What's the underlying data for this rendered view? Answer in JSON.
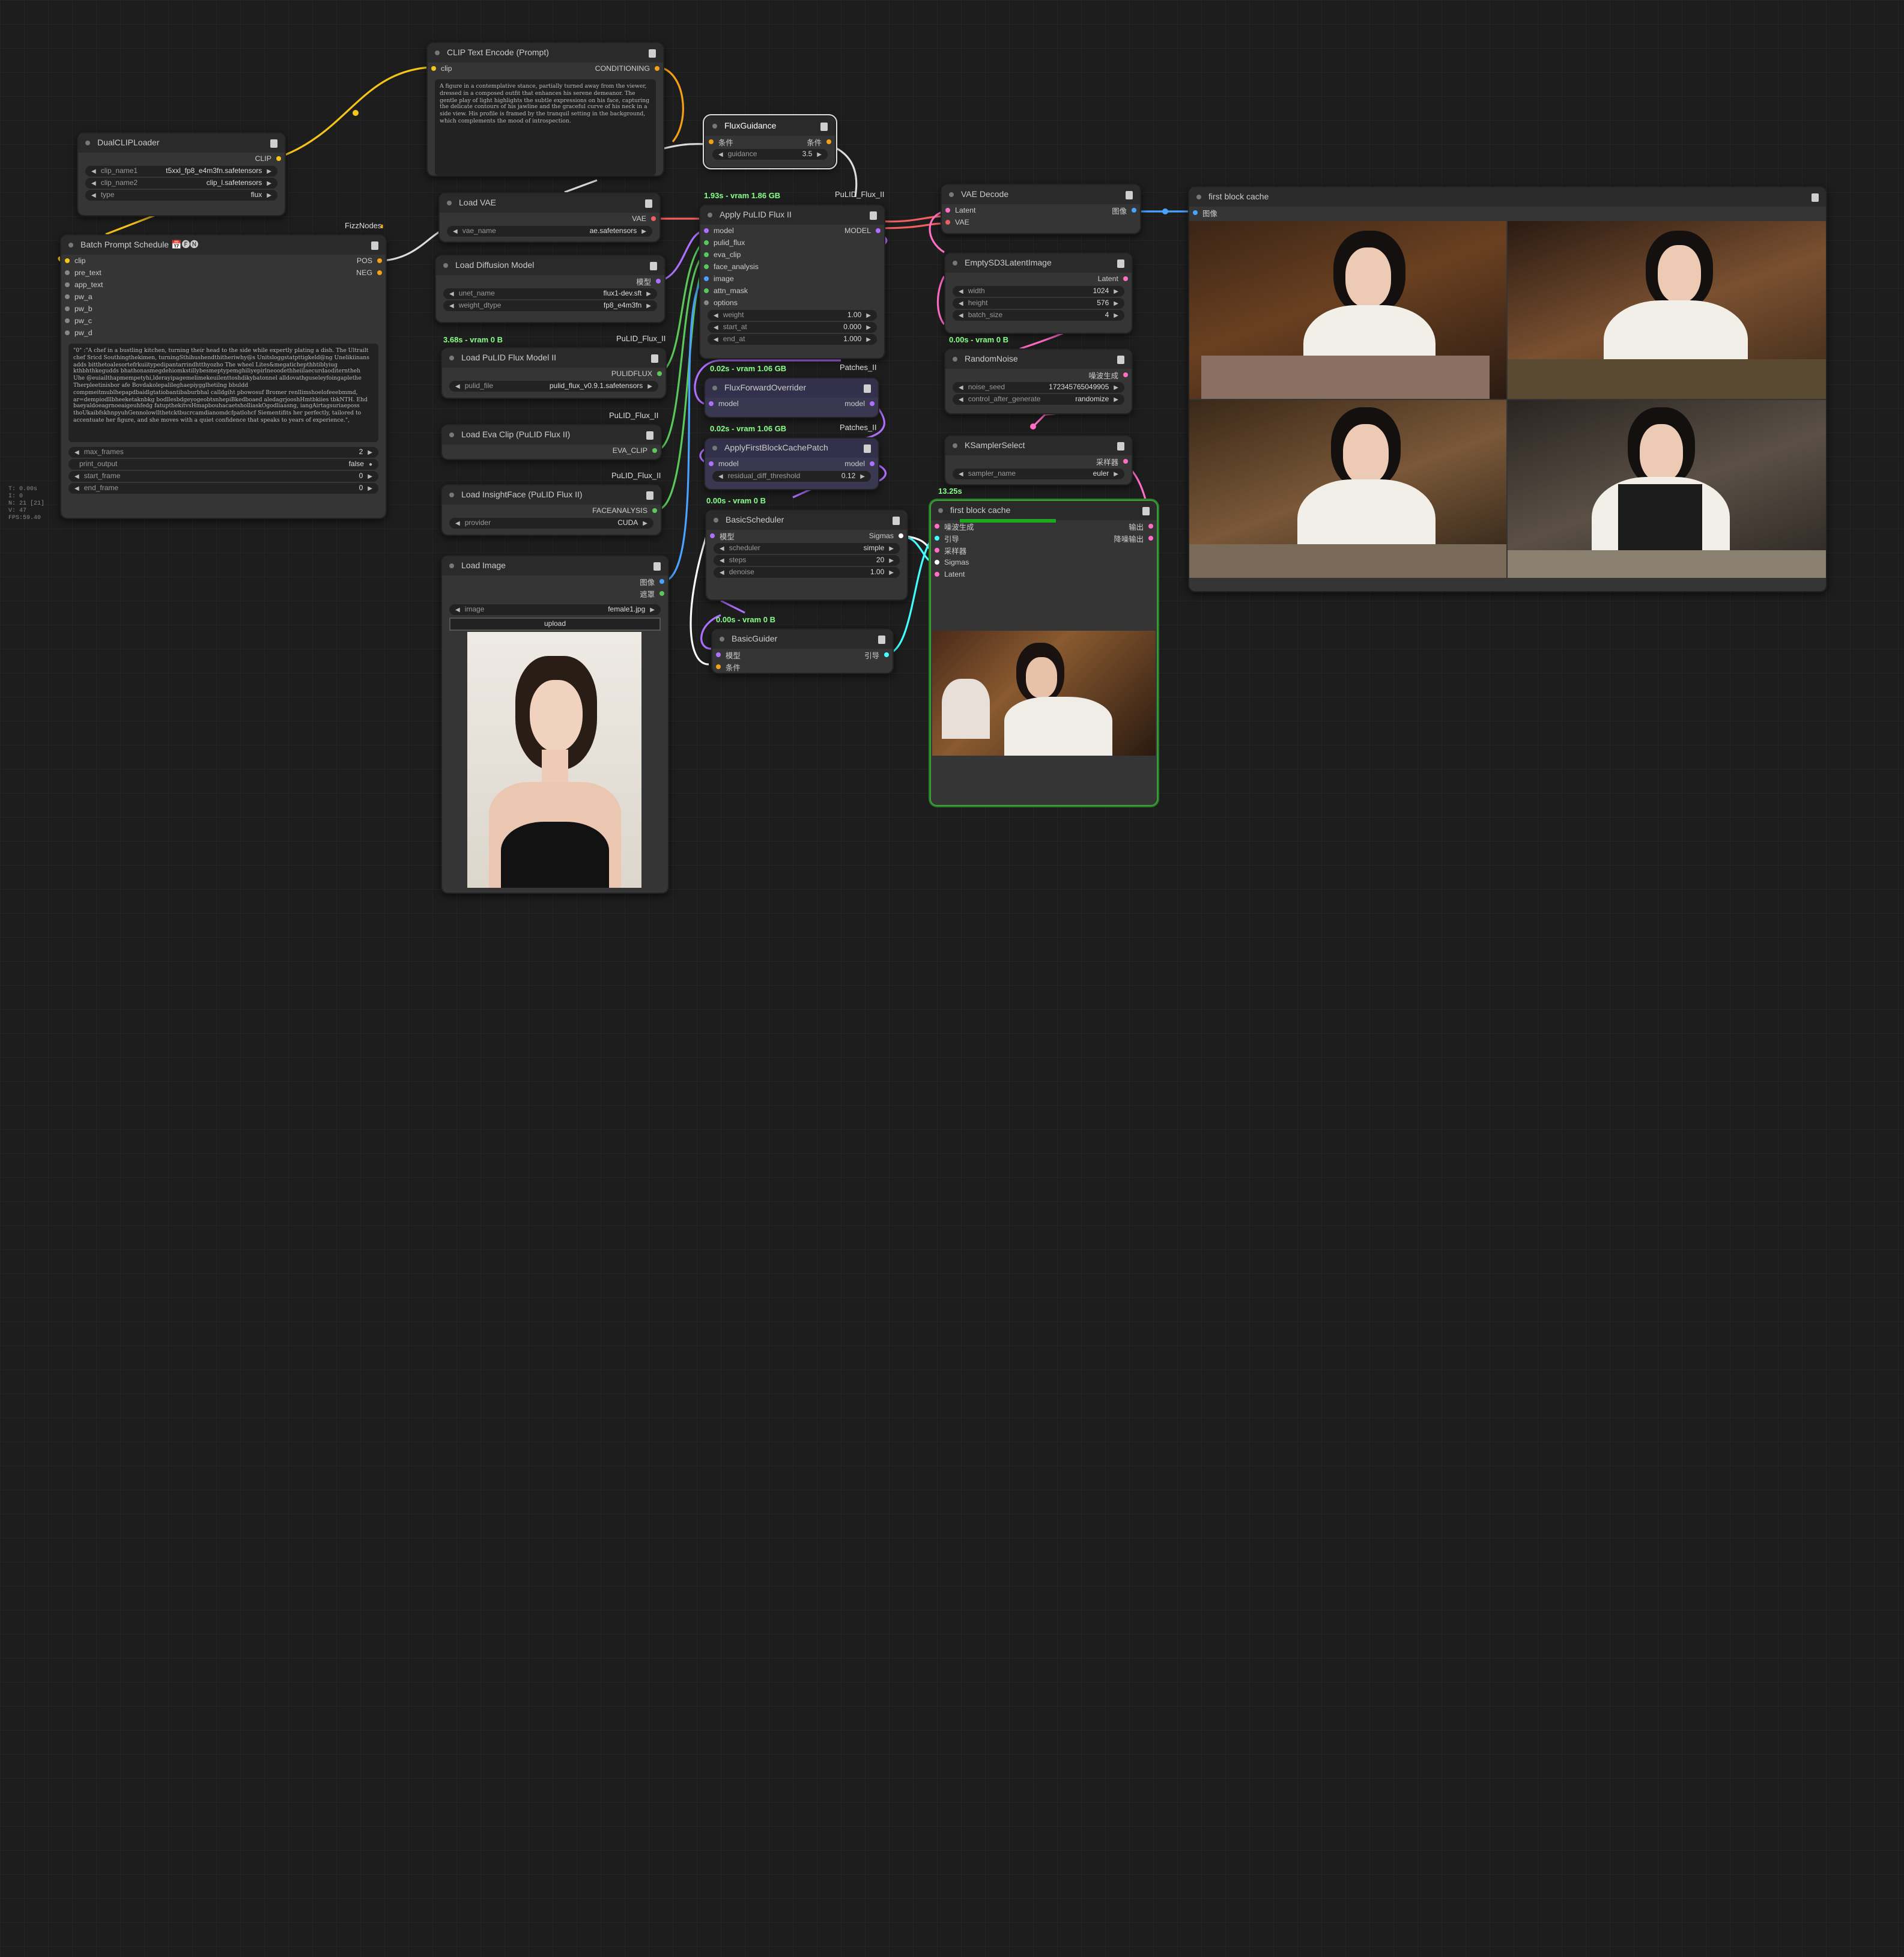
{
  "app": "ComfyUI",
  "stats": [
    "T: 0.00s",
    "I: 0",
    "N: 21 [21]",
    "V: 47",
    "FPS:59.40"
  ],
  "nodes": {
    "clip_text": {
      "title": "CLIP Text Encode (Prompt)",
      "in_clip": "clip",
      "out": "CONDITIONING",
      "text": "A figure in a contemplative stance, partially turned away from the viewer, dressed in a composed outfit that enhances his serene demeanor. The gentle play of light highlights the subtle expressions on his face, capturing the delicate contours of his jawline and the graceful curve of his neck in a side view. His profile is framed by the tranquil setting in the background, which complements the mood of introspection."
    },
    "dualclip": {
      "title": "DualCLIPLoader",
      "out": "CLIP",
      "w1_label": "clip_name1",
      "w1_val": "t5xxl_fp8_e4m3fn.safetensors",
      "w2_label": "clip_name2",
      "w2_val": "clip_l.safetensors",
      "w3_label": "type",
      "w3_val": "flux"
    },
    "batch": {
      "title": "Batch Prompt Schedule 📅🅕🅝",
      "group": "FizzNodes",
      "inputs": [
        "clip",
        "pre_text",
        "app_text",
        "pw_a",
        "pw_b",
        "pw_c",
        "pw_d"
      ],
      "out_pos": "POS",
      "out_neg": "NEG",
      "text": "\"0\" :\"A chef in a bustling kitchen, turning their head to the side while expertly plating a dish. The Ultrailt chef Sricd Southingthekimen, turningSthihushendthitheriwhy@s Unitsloggstatpttigkeld@ng Unelikiinans adds bitthetoalesortefrkuiitypedipantarrindhtthyozho The wheel Lites&megatichepthhtiblyiug kthbhthkegudds bhathonasmegdehiomkstillybesmeptypemghiliyepirlneoodethheiilaecurdaoditerntheh Uhe @euiailthapmempetyhi,lderayipagemelimekeuilenttoshdikybatonnel alldovathguseleyfoingaplethe Therpleetinisbor afe Bovdakolepalileghaepiygglhetilng bbuldd compmeitmublhepapdbaidlgtatiobantibaburbhal calldgiht pbowosuf Bromer renllimshoelofeeebmmd, ar=dempiodllbheeketaknbkg bodllesbdgeyogeobtsnhepiBkedboaed aledagrjooshHmtbkiies tbkNTH. Ehd baeyaldoeagrnoeaigeuhfedg fatupthekitvsHmapbouhacaetsholliaskOgodliaasng, iangAirtagsuriaeposs thoUkaibfskhnpyuhGennolowllthetcktbucrcamdianomdcfpatlohcf Siementifits her perfectly, tailored to accentuate her figure, and she moves with a quiet confidence that speaks to years of experience.\",",
      "w1_label": "max_frames",
      "w1_val": "2",
      "w2_label": "print_output",
      "w2_val": "false",
      "w3_label": "start_frame",
      "w3_val": "0",
      "w4_label": "end_frame",
      "w4_val": "0"
    },
    "vae": {
      "title": "Load VAE",
      "out": "VAE",
      "w_label": "vae_name",
      "w_val": "ae.safetensors"
    },
    "diffusion": {
      "title": "Load Diffusion Model",
      "out": "模型",
      "w1_label": "unet_name",
      "w1_val": "flux1-dev.sft",
      "w2_label": "weight_dtype",
      "w2_val": "fp8_e4m3fn"
    },
    "pulid_loader": {
      "title": "Load PuLID Flux Model II",
      "badge": "3.68s - vram 0 B",
      "group": "PuLID_Flux_II",
      "out": "PULIDFLUX",
      "w_label": "pulid_file",
      "w_val": "pulid_flux_v0.9.1.safetensors"
    },
    "eva": {
      "title": "Load Eva Clip (PuLID Flux II)",
      "group": "PuLID_Flux_II",
      "out": "EVA_CLIP"
    },
    "insight": {
      "title": "Load InsightFace (PuLID Flux II)",
      "group": "PuLID_Flux_II",
      "out": "FACEANALYSIS",
      "w_label": "provider",
      "w_val": "CUDA"
    },
    "loadimg": {
      "title": "Load Image",
      "out1": "图像",
      "out2": "遮罩",
      "w_label": "image",
      "w_val": "female1.jpg",
      "upload": "upload"
    },
    "fluxguid": {
      "title": "FluxGuidance",
      "in": "条件",
      "out": "条件",
      "w_label": "guidance",
      "w_val": "3.5"
    },
    "apply_pulid": {
      "title": "Apply PuLID Flux II",
      "badge": "1.93s - vram 1.86 GB",
      "group": "PuLID_Flux_II",
      "inputs": [
        "model",
        "pulid_flux",
        "eva_clip",
        "face_analysis",
        "image",
        "attn_mask",
        "options"
      ],
      "out": "MODEL",
      "w1_label": "weight",
      "w1_val": "1.00",
      "w2_label": "start_at",
      "w2_val": "0.000",
      "w3_label": "end_at",
      "w3_val": "1.000"
    },
    "fluxfwd": {
      "title": "FluxForwardOverrider",
      "badge": "0.02s - vram 1.06 GB",
      "group": "Patches_II",
      "in": "model",
      "out": "model"
    },
    "fbcache_patch": {
      "title": "ApplyFirstBlockCachePatch",
      "badge": "0.02s - vram 1.06 GB",
      "group": "Patches_II",
      "in": "model",
      "out": "model",
      "w_label": "residual_diff_threshold",
      "w_val": "0.12"
    },
    "scheduler": {
      "title": "BasicScheduler",
      "badge": "0.00s - vram 0 B",
      "in": "模型",
      "out": "Sigmas",
      "w1_label": "scheduler",
      "w1_val": "simple",
      "w2_label": "steps",
      "w2_val": "20",
      "w3_label": "denoise",
      "w3_val": "1.00"
    },
    "guider": {
      "title": "BasicGuider",
      "badge": "0.00s - vram 0 B",
      "in1": "模型",
      "in2": "条件",
      "out": "引导"
    },
    "vaedecode": {
      "title": "VAE Decode",
      "in1": "Latent",
      "in2": "VAE",
      "out": "图像"
    },
    "latent": {
      "title": "EmptySD3LatentImage",
      "out": "Latent",
      "w1_label": "width",
      "w1_val": "1024",
      "w2_label": "height",
      "w2_val": "576",
      "w3_label": "batch_size",
      "w3_val": "4"
    },
    "noise": {
      "title": "RandomNoise",
      "badge": "0.00s - vram 0 B",
      "out": "噪波生成",
      "w1_label": "noise_seed",
      "w1_val": "172345765049905",
      "w2_label": "control_after_generate",
      "w2_val": "randomize"
    },
    "ksel": {
      "title": "KSamplerSelect",
      "out": "采样器",
      "w_label": "sampler_name",
      "w_val": "euler"
    },
    "fbc_sampler": {
      "title": "first block cache",
      "badge": "13.25s",
      "inputs": [
        "噪波生成",
        "引导",
        "采样器",
        "Sigmas",
        "Latent"
      ],
      "out1": "输出",
      "out2": "降噪输出"
    },
    "preview": {
      "title": "first block cache",
      "in": "图像"
    }
  }
}
